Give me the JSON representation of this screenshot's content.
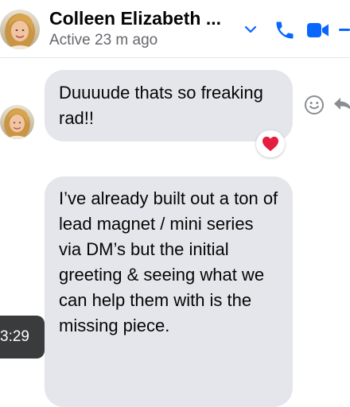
{
  "header": {
    "contact_name": "Colleen Elizabeth ...",
    "status": "Active 23 m ago"
  },
  "messages": [
    {
      "text": "Duuuude thats so freaking rad!!",
      "reaction": "heart"
    },
    {
      "text": "I’ve already built out a ton of lead magnet / mini series via DM’s but the initial greeting & seeing what we can help them with is the missing piece."
    }
  ],
  "tooltip": {
    "time": "3:29"
  },
  "icons": {
    "chevron": "chevron-down-icon",
    "phone": "phone-icon",
    "video": "video-camera-icon",
    "react": "smiley-face-icon",
    "reply": "reply-arrow-icon"
  },
  "colors": {
    "accent": "#0866ff",
    "bubble": "#e4e6eb",
    "heart": "#e41e3f",
    "tooltip_bg": "#3a3b3c"
  }
}
